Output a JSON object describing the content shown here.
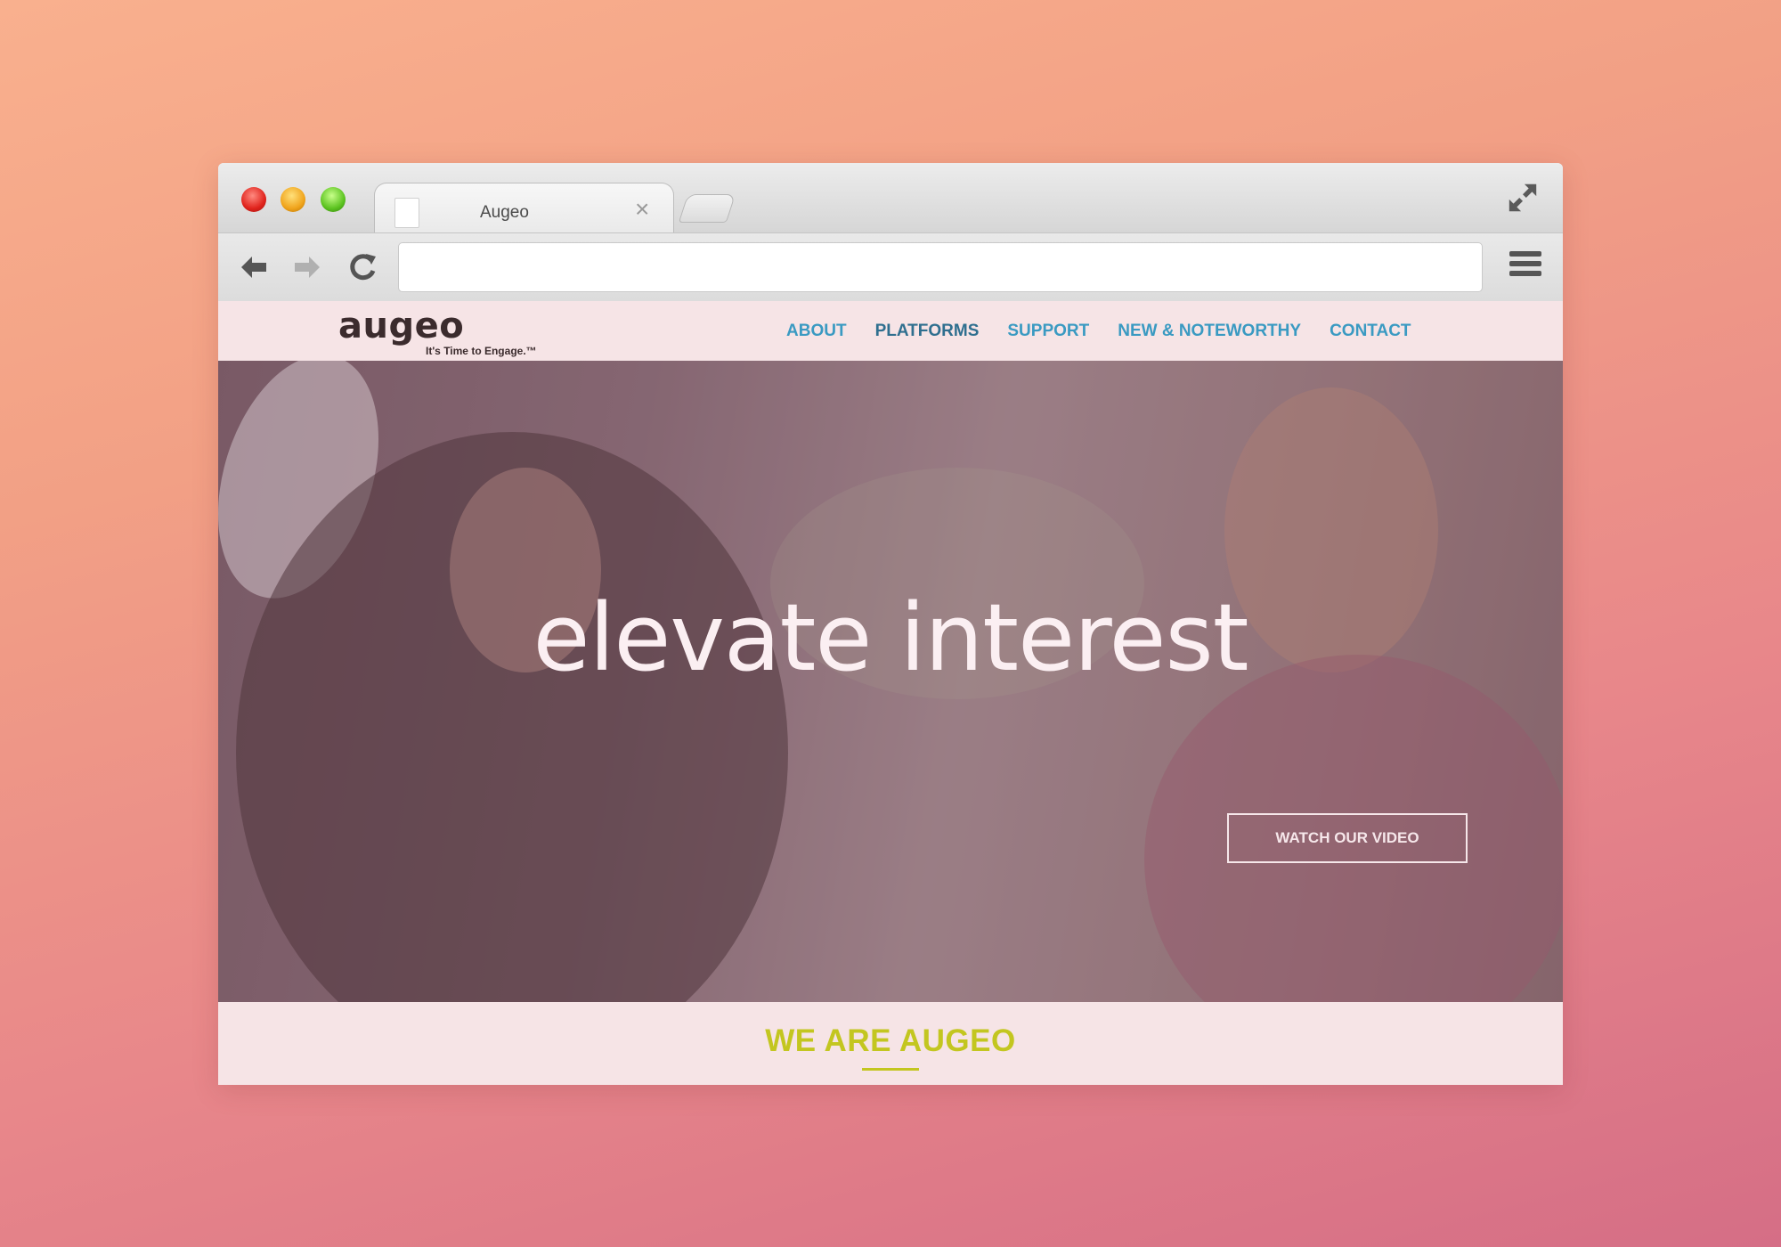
{
  "browser": {
    "tab_title": "Augeo",
    "tab_close": "×",
    "address_value": ""
  },
  "site": {
    "logo": {
      "word": "augeo",
      "tagline": "It's Time to Engage.™"
    },
    "nav": [
      {
        "label": "ABOUT",
        "active": false
      },
      {
        "label": "PLATFORMS",
        "active": true
      },
      {
        "label": "SUPPORT",
        "active": false
      },
      {
        "label": "NEW & NOTEWORTHY",
        "active": false
      },
      {
        "label": "CONTACT",
        "active": false
      }
    ],
    "hero": {
      "headline": "elevate interest",
      "cta_label": "WATCH OUR VIDEO"
    },
    "intro": {
      "heading": "WE ARE AUGEO"
    }
  },
  "colors": {
    "nav_link": "#3a9ac2",
    "nav_active": "#2f6f8f",
    "accent_lime": "#c3c620",
    "header_bg": "#f6e4e6"
  },
  "icons": {
    "back": "arrow-left-icon",
    "forward": "arrow-right-icon",
    "reload": "reload-icon",
    "menu": "hamburger-menu-icon",
    "fullscreen": "fullscreen-icon"
  }
}
